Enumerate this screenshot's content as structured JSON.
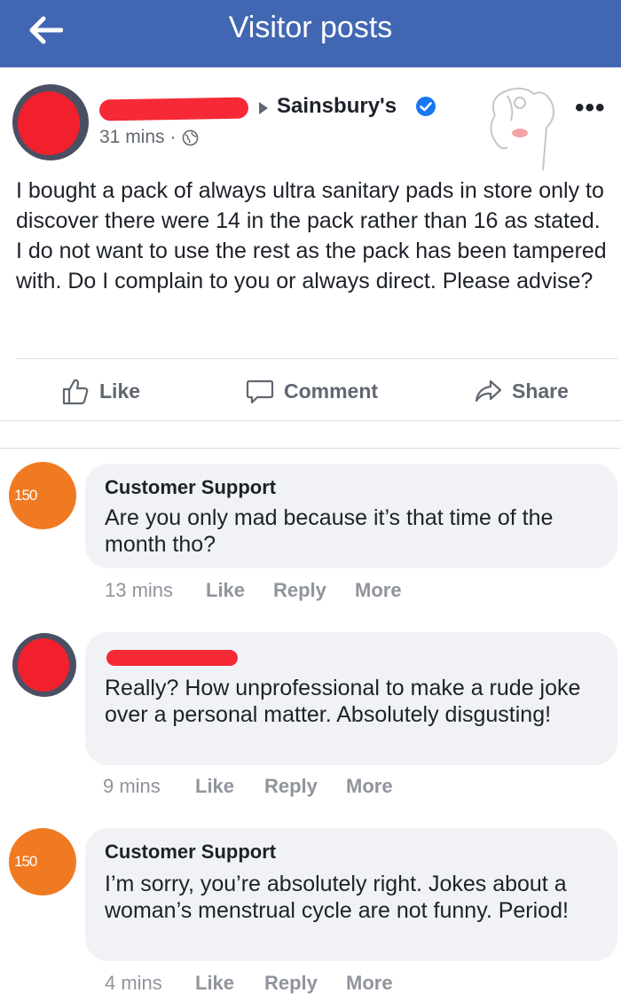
{
  "header": {
    "title": "Visitor posts",
    "back_icon": "arrow-left-icon"
  },
  "post": {
    "author_redacted": true,
    "page_name": "Sainsbury's",
    "time": "31 mins",
    "privacy_icon": "globe-icon",
    "text": "I bought a pack of always ultra sanitary pads in store only to discover there were 14 in the pack rather than 16 as stated. I do not want to use the rest as the pack has been tampered with. Do I complain to you or always direct. Please advise?",
    "more_label": "•••"
  },
  "actions": {
    "like": "Like",
    "comment": "Comment",
    "share": "Share"
  },
  "comments": [
    {
      "author": "Customer Support",
      "text": "Are you only mad because it’s that time of the month tho?",
      "time": "13 mins",
      "like": "Like",
      "reply": "Reply",
      "more": "More"
    },
    {
      "author": "",
      "author_redacted": true,
      "text": "Really? How unprofessional to make a rude joke over a personal matter. Absolutely disgusting!",
      "time": "9 mins",
      "like": "Like",
      "reply": "Reply",
      "more": "More"
    },
    {
      "author": "Customer Support",
      "text": "I’m sorry, you’re absolutely right. Jokes about a woman’s menstrual cycle are not funny. Period!",
      "time": "4 mins",
      "like": "Like",
      "reply": "Reply",
      "more": "More"
    }
  ],
  "brand_avatar": {
    "number": "150"
  },
  "colors": {
    "header_blue": "#4267b2",
    "brand_orange": "#f07a22",
    "redaction_red": "#f52a36",
    "verified_blue": "#1877f2",
    "bubble_gray": "#f0f2f5"
  }
}
